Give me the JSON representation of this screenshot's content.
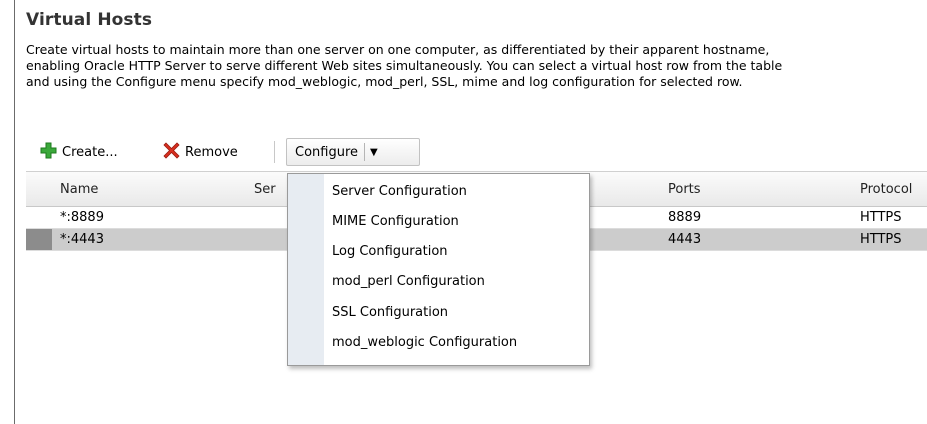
{
  "page": {
    "title": "Virtual Hosts",
    "description_lines": [
      "Create virtual hosts to maintain more than one server on one computer, as differentiated by their apparent hostname,",
      "enabling Oracle HTTP Server to serve different Web sites simultaneously. You can select a virtual host row from the table",
      "and using the Configure menu specify mod_weblogic, mod_perl, SSL, mime and log configuration for selected row."
    ]
  },
  "toolbar": {
    "create_label": "Create...",
    "remove_label": "Remove",
    "configure_label": "Configure",
    "create_icon": "plus-icon",
    "remove_icon": "x-icon",
    "create_icon_color": "#3aa83a",
    "remove_icon_color": "#d83020"
  },
  "table": {
    "columns": [
      "Name",
      "Ser",
      "Ports",
      "Protocol"
    ],
    "rows": [
      {
        "name": "*:8889",
        "ports": "8889",
        "protocol": "HTTPS",
        "selected": false
      },
      {
        "name": "*:4443",
        "ports": "4443",
        "protocol": "HTTPS",
        "selected": true
      }
    ]
  },
  "configure_menu": {
    "items": [
      "Server Configuration",
      "MIME Configuration",
      "Log Configuration",
      "mod_perl Configuration",
      "SSL Configuration",
      "mod_weblogic Configuration"
    ]
  }
}
